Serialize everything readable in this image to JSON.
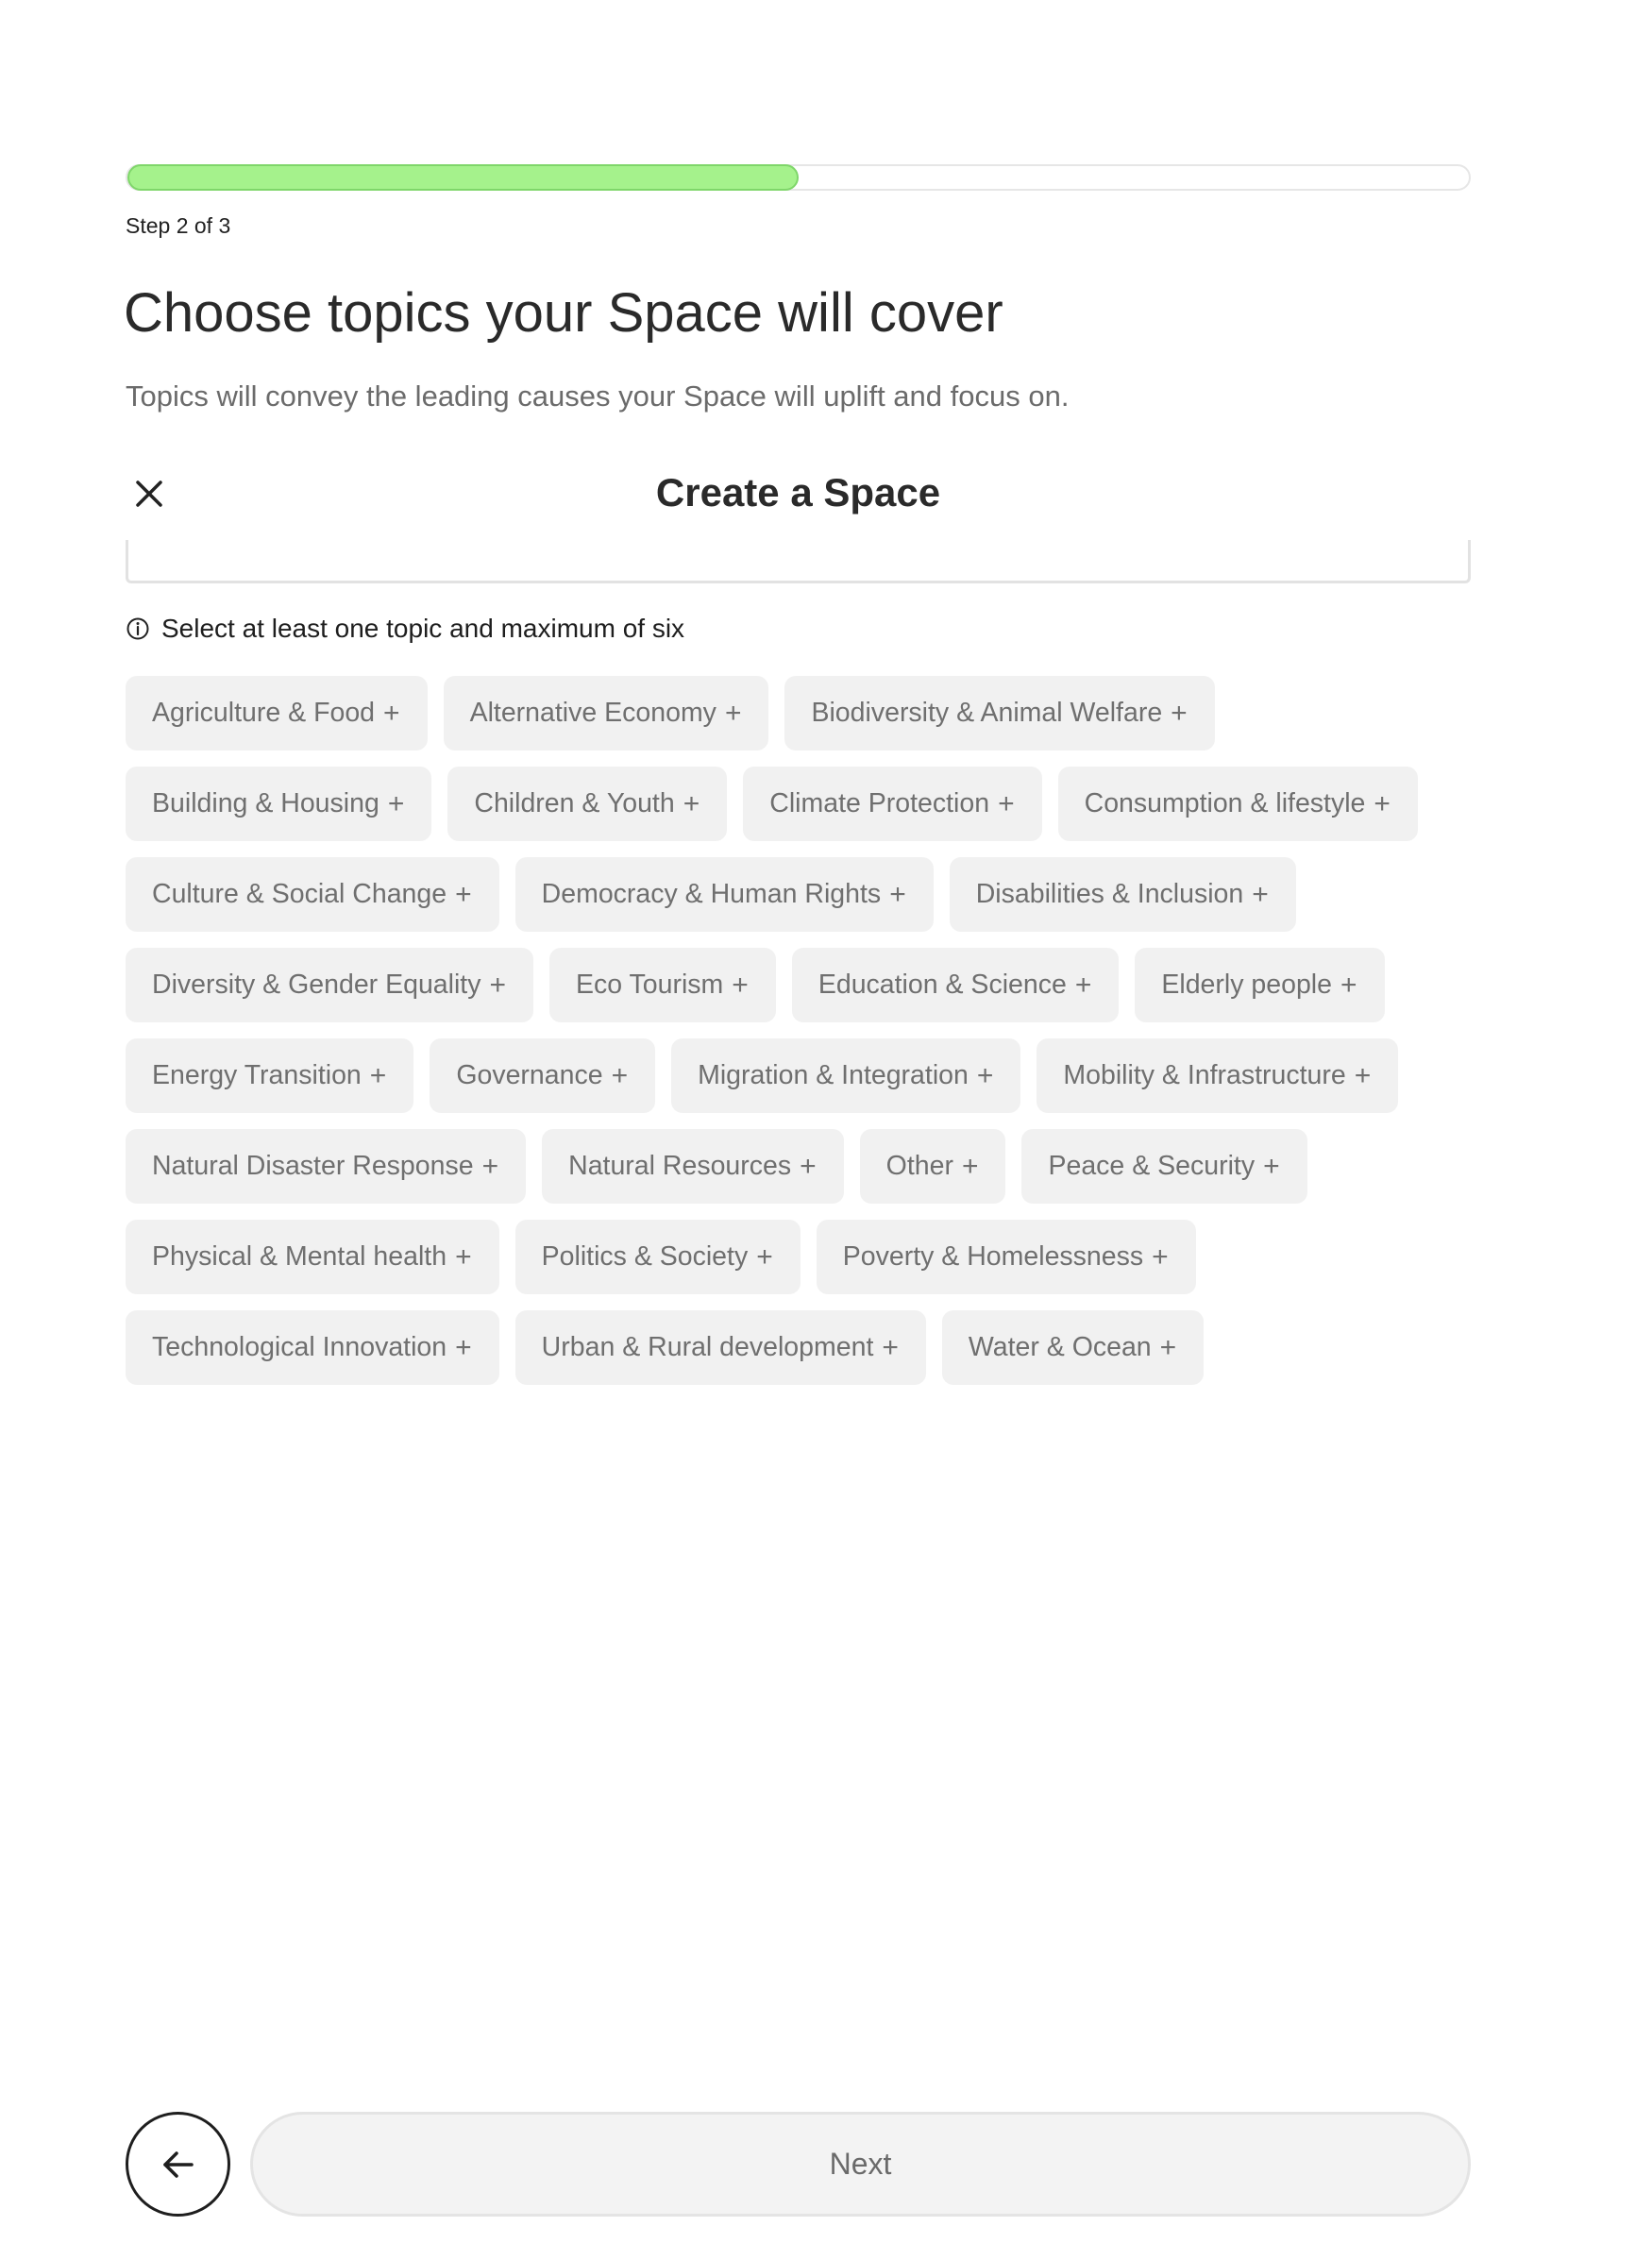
{
  "progress": {
    "fraction": 0.5,
    "step_label": "Step 2 of 3",
    "fill_color": "#a5f28c"
  },
  "header": {
    "title": "Choose topics your Space will cover",
    "subtitle": "Topics will convey the leading causes your Space will uplift and focus on."
  },
  "modal": {
    "title": "Create a Space",
    "close_icon": "close-icon"
  },
  "topics_section": {
    "info_text": "Select at least one topic and maximum of six",
    "info_icon": "info-icon",
    "items": [
      {
        "label": "Agriculture & Food"
      },
      {
        "label": "Alternative Economy"
      },
      {
        "label": "Biodiversity & Animal Welfare"
      },
      {
        "label": "Building & Housing"
      },
      {
        "label": "Children & Youth"
      },
      {
        "label": "Climate Protection"
      },
      {
        "label": "Consumption & lifestyle"
      },
      {
        "label": "Culture & Social Change"
      },
      {
        "label": "Democracy & Human Rights"
      },
      {
        "label": "Disabilities & Inclusion"
      },
      {
        "label": "Diversity & Gender Equality"
      },
      {
        "label": "Eco Tourism"
      },
      {
        "label": "Education & Science"
      },
      {
        "label": "Elderly people"
      },
      {
        "label": "Energy Transition"
      },
      {
        "label": "Governance"
      },
      {
        "label": "Migration & Integration"
      },
      {
        "label": "Mobility & Infrastructure"
      },
      {
        "label": "Natural Disaster Response"
      },
      {
        "label": "Natural Resources"
      },
      {
        "label": "Other"
      },
      {
        "label": "Peace & Security"
      },
      {
        "label": "Physical & Mental health"
      },
      {
        "label": "Politics & Society"
      },
      {
        "label": "Poverty & Homelessness"
      },
      {
        "label": "Technological Innovation"
      },
      {
        "label": "Urban & Rural development"
      },
      {
        "label": "Water & Ocean"
      }
    ],
    "add_symbol": "+"
  },
  "footer": {
    "back_icon": "arrow-left-icon",
    "next_label": "Next"
  }
}
